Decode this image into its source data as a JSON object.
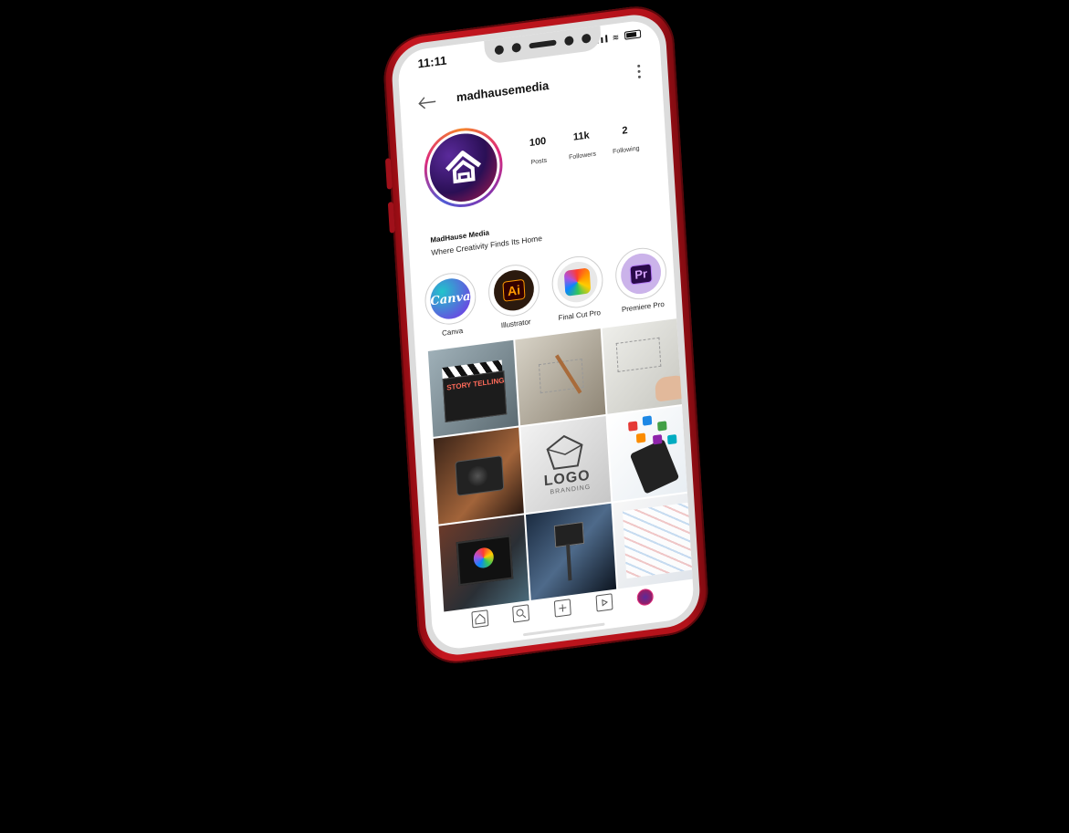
{
  "status_bar": {
    "time": "11:11"
  },
  "header": {
    "username": "madhausemedia"
  },
  "profile": {
    "stats": [
      {
        "value": "100",
        "label": "Posts"
      },
      {
        "value": "11k",
        "label": "Followers"
      },
      {
        "value": "2",
        "label": "Following"
      }
    ],
    "display_name": "MadHause Media",
    "bio": "Where Creativity Finds Its Home"
  },
  "highlights": [
    {
      "label": "Canva",
      "icon": "canva-icon",
      "glyph": "Canva"
    },
    {
      "label": "Illustrator",
      "icon": "illustrator-icon",
      "glyph": "Ai"
    },
    {
      "label": "Final Cut Pro",
      "icon": "final-cut-pro-icon",
      "glyph": ""
    },
    {
      "label": "Premiere Pro",
      "icon": "premiere-pro-icon",
      "glyph": "Pr"
    }
  ],
  "posts": {
    "storytelling": "STORY TELLING",
    "logo": "LOGO",
    "branding": "BRANDING"
  },
  "nav": [
    "home-icon",
    "search-icon",
    "add-post-icon",
    "reels-icon",
    "profile-avatar"
  ],
  "colors": {
    "phone_body": "#c4161f",
    "accent_ring": "#dd2a7b"
  }
}
